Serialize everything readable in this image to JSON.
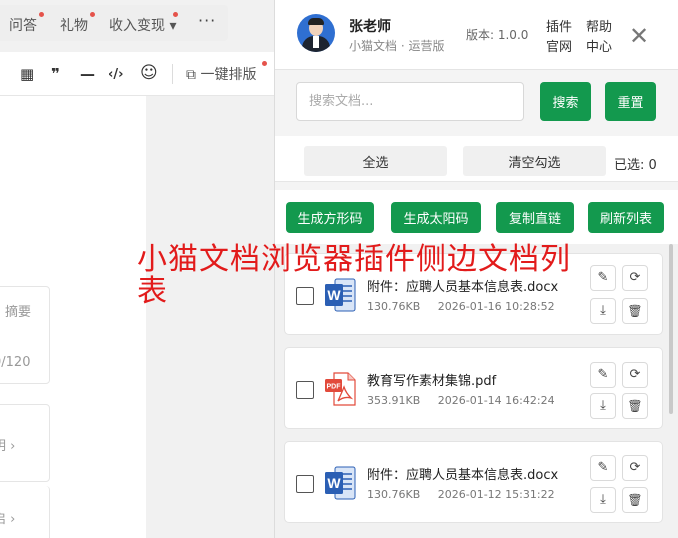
{
  "editor": {
    "nav": [
      {
        "label": "问答",
        "dot": true
      },
      {
        "label": "礼物",
        "dot": true
      },
      {
        "label": "收入变现 ▾",
        "dot": true
      }
    ],
    "more": "···",
    "toolbar": {
      "table": "▦",
      "quote": "❞",
      "divider": "—",
      "code": "‹/›",
      "emoji": "☺",
      "format_label": "一键排版"
    },
    "fragments": {
      "summary": "摘要",
      "counter": "0/120",
      "explain": "明 ›",
      "enable": "启 ›"
    }
  },
  "overlay_title": "小猫文档浏览器插件侧边文档列表",
  "panel": {
    "header": {
      "username": "张老师",
      "subtitle": "小猫文档 · 运营版",
      "version": "版本: 1.0.0",
      "links": {
        "plugin": "插件",
        "help": "帮助",
        "site": "官网",
        "center": "中心"
      },
      "close": "✕"
    },
    "search": {
      "placeholder": "搜索文档...",
      "value": "",
      "search_btn": "搜索",
      "reset_btn": "重置"
    },
    "selection": {
      "select_all": "全选",
      "clear": "清空勾选",
      "count_label": "已选: 0"
    },
    "actions": {
      "square_code": "生成方形码",
      "sun_code": "生成太阳码",
      "copy_link": "复制直链",
      "refresh": "刷新列表"
    },
    "files": [
      {
        "name": "附件：应聘人员基本信息表.docx",
        "size": "130.76KB",
        "date": "2026-01-16 10:28:52",
        "type": "word"
      },
      {
        "name": "教育写作素材集锦.pdf",
        "size": "353.91KB",
        "date": "2026-01-14 16:42:24",
        "type": "pdf"
      },
      {
        "name": "附件：应聘人员基本信息表.docx",
        "size": "130.76KB",
        "date": "2026-01-12 15:31:22",
        "type": "word"
      }
    ],
    "icons": {
      "edit": "✎",
      "refresh": "⟳",
      "download": "⤓",
      "delete": "🗑"
    }
  },
  "colors": {
    "accent_green": "#13994e",
    "overlay_red": "#e21b1b",
    "word_blue": "#2b5fb4",
    "pdf_red": "#e24a3b"
  }
}
